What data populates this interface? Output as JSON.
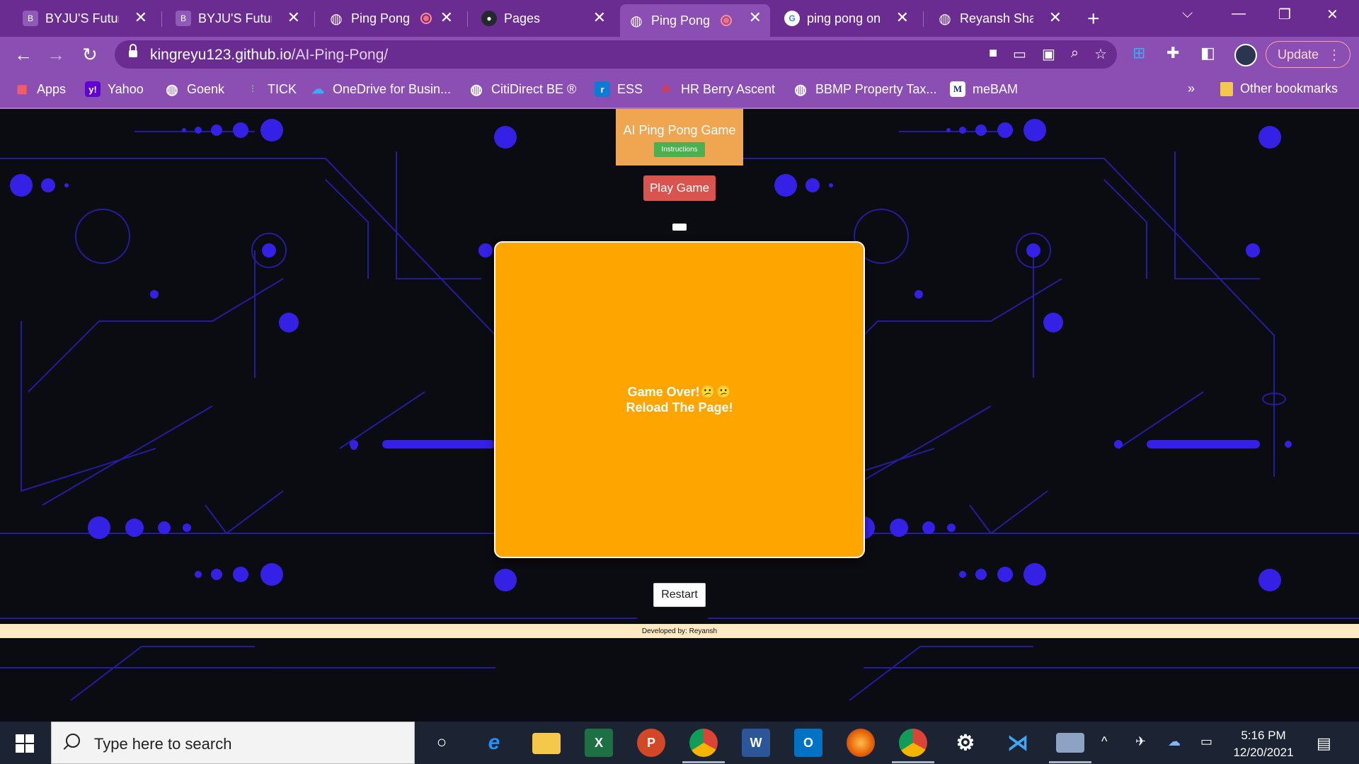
{
  "browser": {
    "tabs": [
      {
        "title": "BYJU'S FutureS",
        "icon": "byjus-icon"
      },
      {
        "title": "BYJU'S FutureS",
        "icon": "byjus-icon"
      },
      {
        "title": "Ping Pong",
        "icon": "globe-icon",
        "recording": true
      },
      {
        "title": "Pages",
        "icon": "github-icon"
      },
      {
        "title": "Ping Pong",
        "icon": "globe-icon",
        "recording": true,
        "active": true
      },
      {
        "title": "ping pong onli",
        "icon": "google-icon"
      },
      {
        "title": "Reyansh Shah",
        "icon": "globe-icon"
      }
    ],
    "address": {
      "host": "kingreyu123.github.io",
      "path": "/AI-Ping-Pong/"
    },
    "update_label": "Update",
    "bookmarks": [
      {
        "label": "Apps",
        "icon": "apps-grid-icon"
      },
      {
        "label": "Yahoo",
        "icon": "yahoo-icon"
      },
      {
        "label": "Goenk",
        "icon": "globe-icon"
      },
      {
        "label": "TICK",
        "icon": "tick-chart-icon"
      },
      {
        "label": "OneDrive for Busin...",
        "icon": "onedrive-icon"
      },
      {
        "label": "CitiDirect BE ®",
        "icon": "globe-icon"
      },
      {
        "label": "ESS",
        "icon": "ess-icon"
      },
      {
        "label": "HR Berry Ascent",
        "icon": "berry-icon"
      },
      {
        "label": "BBMP Property Tax...",
        "icon": "globe-icon"
      },
      {
        "label": "meBAM",
        "icon": "mebam-icon"
      }
    ],
    "other_bookmarks": "Other bookmarks",
    "overflow": "»"
  },
  "page": {
    "title": "AI Ping Pong Game",
    "instructions_label": "Instructions",
    "play_label": "Play Game",
    "game_over_line1": "Game Over!😕😕",
    "game_over_line2": "Reload The Page!",
    "restart_label": "Restart",
    "footer": "Developed by: Reyansh",
    "colors": {
      "header": "#f0a651",
      "canvas": "#ffa500",
      "play": "#d9534f",
      "instructions": "#4caf50",
      "footer": "#fde9c4"
    }
  },
  "taskbar": {
    "search_placeholder": "Type here to search",
    "apps": [
      "cortana-icon",
      "ie-icon",
      "file-explorer-icon",
      "excel-icon",
      "powerpoint-icon",
      "chrome-icon",
      "word-icon",
      "outlook-icon",
      "firefox-icon",
      "chrome-profile-icon",
      "settings-icon",
      "vscode-icon",
      "camera-icon"
    ],
    "time": "5:16 PM",
    "date": "12/20/2021"
  }
}
